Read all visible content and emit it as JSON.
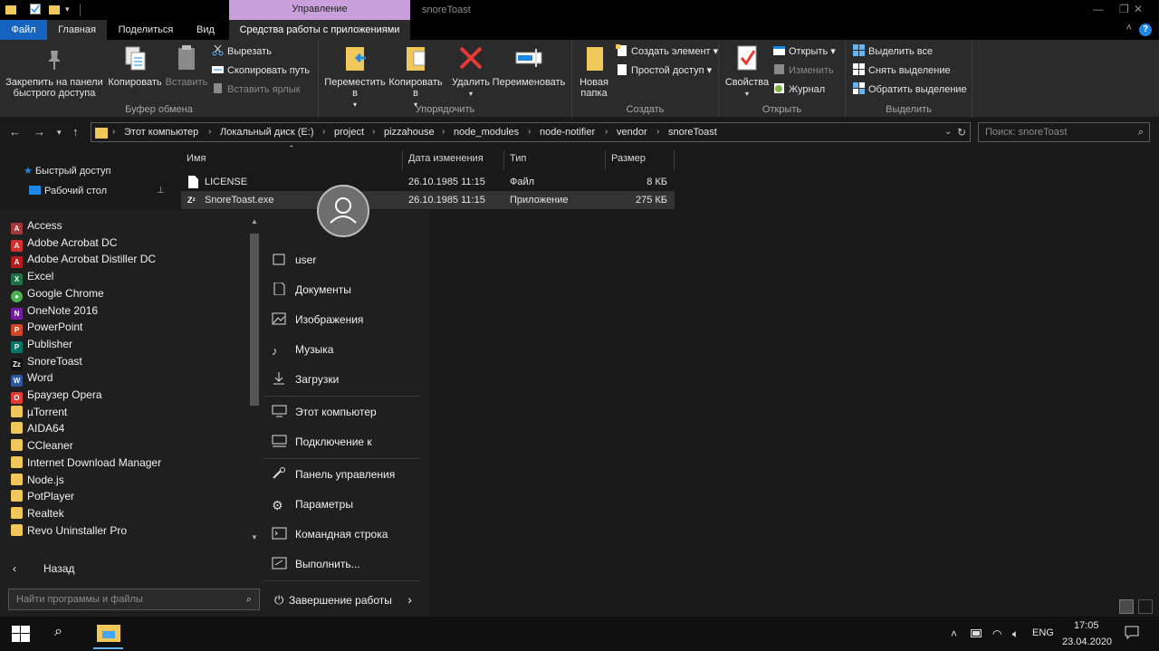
{
  "titlebar": {
    "manage_tab": "Управление",
    "title": "snoreToast",
    "minimize": "—",
    "maximize": "❐",
    "close": "✕"
  },
  "tabs": {
    "file": "Файл",
    "home": "Главная",
    "share": "Поделиться",
    "view": "Вид",
    "app_tools": "Средства работы с приложениями"
  },
  "ribbon": {
    "clipboard": {
      "label": "Буфер обмена",
      "pin": "Закрепить на панели быстрого доступа",
      "copy": "Копировать",
      "paste": "Вставить",
      "cut": "Вырезать",
      "copy_path": "Скопировать путь",
      "paste_shortcut": "Вставить ярлык"
    },
    "organize": {
      "label": "Упорядочить",
      "move_to": "Переместить в",
      "copy_to": "Копировать в",
      "delete": "Удалить",
      "rename": "Переименовать"
    },
    "new": {
      "label": "Создать",
      "new_folder": "Новая папка",
      "new_item": "Создать элемент",
      "easy_access": "Простой доступ"
    },
    "open": {
      "label": "Открыть",
      "properties": "Свойства",
      "open": "Открыть",
      "edit": "Изменить",
      "history": "Журнал"
    },
    "select": {
      "label": "Выделить",
      "select_all": "Выделить все",
      "select_none": "Снять выделение",
      "invert": "Обратить выделение"
    }
  },
  "address": {
    "crumbs": [
      "Этот компьютер",
      "Локальный диск (E:)",
      "project",
      "pizzahouse",
      "node_modules",
      "node-notifier",
      "vendor",
      "snoreToast"
    ],
    "search_placeholder": "Поиск: snoreToast"
  },
  "navpane": {
    "quick_access": "Быстрый доступ",
    "desktop": "Рабочий стол"
  },
  "columns": {
    "name": "Имя",
    "date": "Дата изменения",
    "type": "Тип",
    "size": "Размер"
  },
  "files": [
    {
      "name": "LICENSE",
      "date": "26.10.1985 11:15",
      "type": "Файл",
      "size": "8 КБ"
    },
    {
      "name": "SnoreToast.exe",
      "date": "26.10.1985 11:15",
      "type": "Приложение",
      "size": "275 КБ"
    }
  ],
  "startmenu": {
    "apps": [
      {
        "name": "Access",
        "icon": "access-icon",
        "color": "#a4373a",
        "glyph": "A"
      },
      {
        "name": "Adobe Acrobat DC",
        "icon": "acrobat-icon",
        "color": "#d32f2f",
        "glyph": "A"
      },
      {
        "name": "Adobe Acrobat Distiller DC",
        "icon": "distiller-icon",
        "color": "#b71c1c",
        "glyph": "A"
      },
      {
        "name": "Excel",
        "icon": "excel-icon",
        "color": "#1e7145",
        "glyph": "X"
      },
      {
        "name": "Google Chrome",
        "icon": "chrome-icon",
        "color": "#4caf50",
        "glyph": "●"
      },
      {
        "name": "OneNote 2016",
        "icon": "onenote-icon",
        "color": "#7719aa",
        "glyph": "N"
      },
      {
        "name": "PowerPoint",
        "icon": "powerpoint-icon",
        "color": "#d24726",
        "glyph": "P"
      },
      {
        "name": "Publisher",
        "icon": "publisher-icon",
        "color": "#077568",
        "glyph": "P"
      },
      {
        "name": "SnoreToast",
        "icon": "snoretoast-icon",
        "color": "#111111",
        "glyph": "Zz"
      },
      {
        "name": "Word",
        "icon": "word-icon",
        "color": "#2b579a",
        "glyph": "W"
      },
      {
        "name": "Браузер Opera",
        "icon": "opera-icon",
        "color": "#e53935",
        "glyph": "O"
      },
      {
        "name": "µTorrent",
        "icon": "folder-icon",
        "color": "#f0c85a",
        "glyph": ""
      },
      {
        "name": "AIDA64",
        "icon": "folder-icon",
        "color": "#f0c85a",
        "glyph": ""
      },
      {
        "name": "CCleaner",
        "icon": "folder-icon",
        "color": "#f0c85a",
        "glyph": ""
      },
      {
        "name": "Internet Download Manager",
        "icon": "folder-icon",
        "color": "#f0c85a",
        "glyph": ""
      },
      {
        "name": "Node.js",
        "icon": "folder-icon",
        "color": "#f0c85a",
        "glyph": ""
      },
      {
        "name": "PotPlayer",
        "icon": "folder-icon",
        "color": "#f0c85a",
        "glyph": ""
      },
      {
        "name": "Realtek",
        "icon": "folder-icon",
        "color": "#f0c85a",
        "glyph": ""
      },
      {
        "name": "Revo Uninstaller Pro",
        "icon": "folder-icon",
        "color": "#f0c85a",
        "glyph": ""
      }
    ],
    "back": "Назад",
    "search_placeholder": "Найти программы и файлы",
    "places": {
      "user": "user",
      "documents": "Документы",
      "pictures": "Изображения",
      "music": "Музыка",
      "downloads": "Загрузки",
      "computer": "Этот компьютер",
      "connect": "Подключение к",
      "control_panel": "Панель управления",
      "settings": "Параметры",
      "cmd": "Командная строка",
      "run": "Выполнить...",
      "shutdown": "Завершение работы"
    }
  },
  "taskbar": {
    "lang": "ENG",
    "time": "17:05",
    "date": "23.04.2020"
  }
}
